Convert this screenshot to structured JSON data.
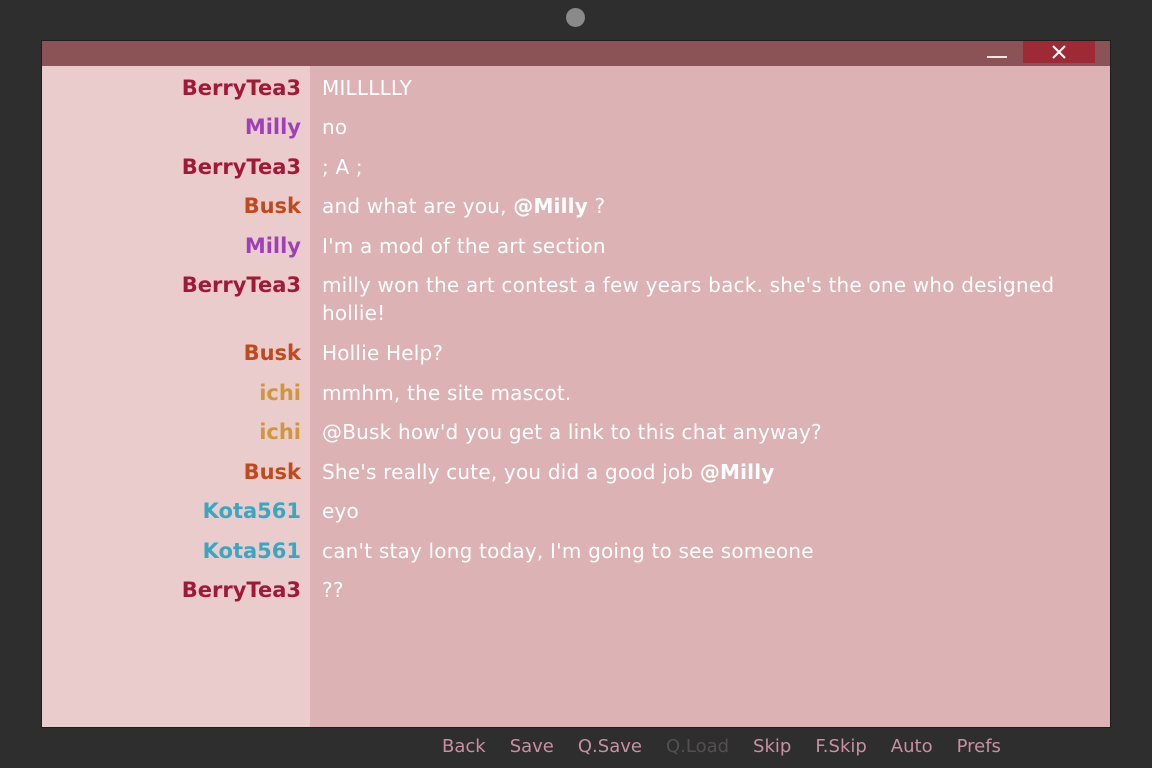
{
  "window": {
    "minimize_label": "—",
    "close_label": "✕"
  },
  "colors": {
    "BerryTea3": "#a01a38",
    "Milly": "#a040b8",
    "Busk": "#c04a1c",
    "ichi": "#d0963a",
    "Kota561": "#3aa6c0"
  },
  "messages": [
    {
      "speaker": "BerryTea3",
      "parts": [
        {
          "text": "MILLLLLY"
        }
      ]
    },
    {
      "speaker": "Milly",
      "parts": [
        {
          "text": "no"
        }
      ]
    },
    {
      "speaker": "BerryTea3",
      "parts": [
        {
          "text": "; A ;"
        }
      ]
    },
    {
      "speaker": "Busk",
      "parts": [
        {
          "text": "and what are you, "
        },
        {
          "text": "@Milly",
          "mention": true
        },
        {
          "text": " ?"
        }
      ]
    },
    {
      "speaker": "Milly",
      "parts": [
        {
          "text": "I'm a mod of the art section"
        }
      ]
    },
    {
      "speaker": "BerryTea3",
      "parts": [
        {
          "text": "milly won the art contest a few years back. she's the one who designed hollie!"
        }
      ]
    },
    {
      "speaker": "Busk",
      "parts": [
        {
          "text": "Hollie Help?"
        }
      ]
    },
    {
      "speaker": "ichi",
      "parts": [
        {
          "text": "mmhm, the site mascot."
        }
      ]
    },
    {
      "speaker": "ichi",
      "parts": [
        {
          "text": "@Busk how'd you get a link to this chat anyway?"
        }
      ]
    },
    {
      "speaker": "Busk",
      "parts": [
        {
          "text": "She's really cute, you did a good job "
        },
        {
          "text": "@Milly",
          "mention": true
        }
      ]
    },
    {
      "speaker": "Kota561",
      "parts": [
        {
          "text": "eyo"
        }
      ]
    },
    {
      "speaker": "Kota561",
      "parts": [
        {
          "text": "can't stay long today, I'm going to see someone"
        }
      ]
    },
    {
      "speaker": "BerryTea3",
      "parts": [
        {
          "text": "??"
        }
      ]
    }
  ],
  "quick_menu": [
    {
      "label": "Back",
      "enabled": true
    },
    {
      "label": "Save",
      "enabled": true
    },
    {
      "label": "Q.Save",
      "enabled": true
    },
    {
      "label": "Q.Load",
      "enabled": false
    },
    {
      "label": "Skip",
      "enabled": true
    },
    {
      "label": "F.Skip",
      "enabled": true
    },
    {
      "label": "Auto",
      "enabled": true
    },
    {
      "label": "Prefs",
      "enabled": true
    }
  ]
}
